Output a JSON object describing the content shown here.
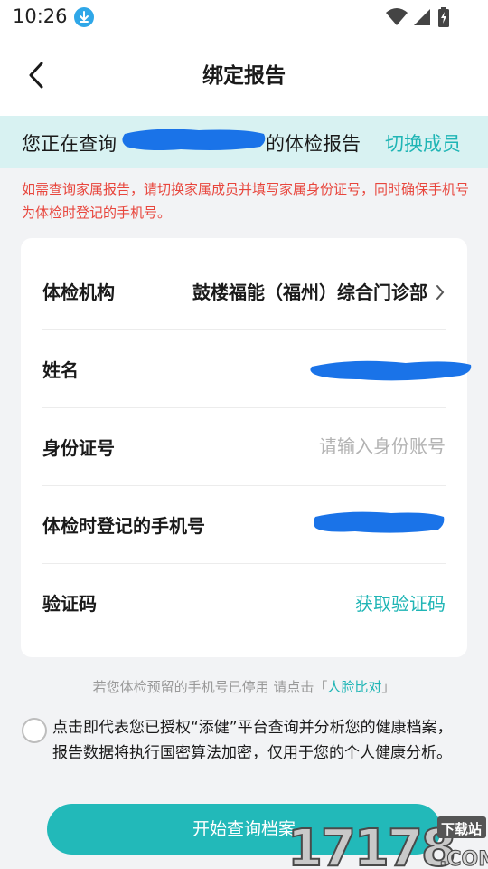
{
  "status_bar": {
    "time": "10:26",
    "icons": [
      "download-icon",
      "wifi-icon",
      "signal-icon",
      "battery-icon"
    ]
  },
  "nav": {
    "title": "绑定报告",
    "back_icon": "chevron-left-icon"
  },
  "banner": {
    "prefix": "您正在查询",
    "suffix": "的体检报告",
    "switch_label": "切换成员"
  },
  "warning": "如需查询家属报告，请切换家属成员并填写家属身份证号，同时确保手机号为体检时登记的手机号。",
  "form": {
    "institution": {
      "label": "体检机构",
      "value": "鼓楼福能（福州）综合门诊部"
    },
    "name": {
      "label": "姓名"
    },
    "id_number": {
      "label": "身份证号",
      "placeholder": "请输入身份账号",
      "value": ""
    },
    "phone": {
      "label": "体检时登记的手机号"
    },
    "code": {
      "label": "验证码",
      "action": "获取验证码"
    }
  },
  "face_hint": {
    "text": "若您体检预留的手机号已停用 请点击「",
    "link": "人脸比对",
    "end": "」"
  },
  "consent": {
    "checked": false,
    "text": "点击即代表您已授权“添健”平台查询并分析您的健康档案，报告数据将执行国密算法加密，仅用于您的个人健康分析。"
  },
  "start_button": "开始查询档案",
  "watermark": {
    "number": "17178",
    "tag": "下载站",
    "domain": ".COM"
  },
  "colors": {
    "accent": "#1fb5b5",
    "warning": "#e8453c",
    "banner_bg": "#d8f2f2",
    "redaction": "#1a73e8"
  }
}
